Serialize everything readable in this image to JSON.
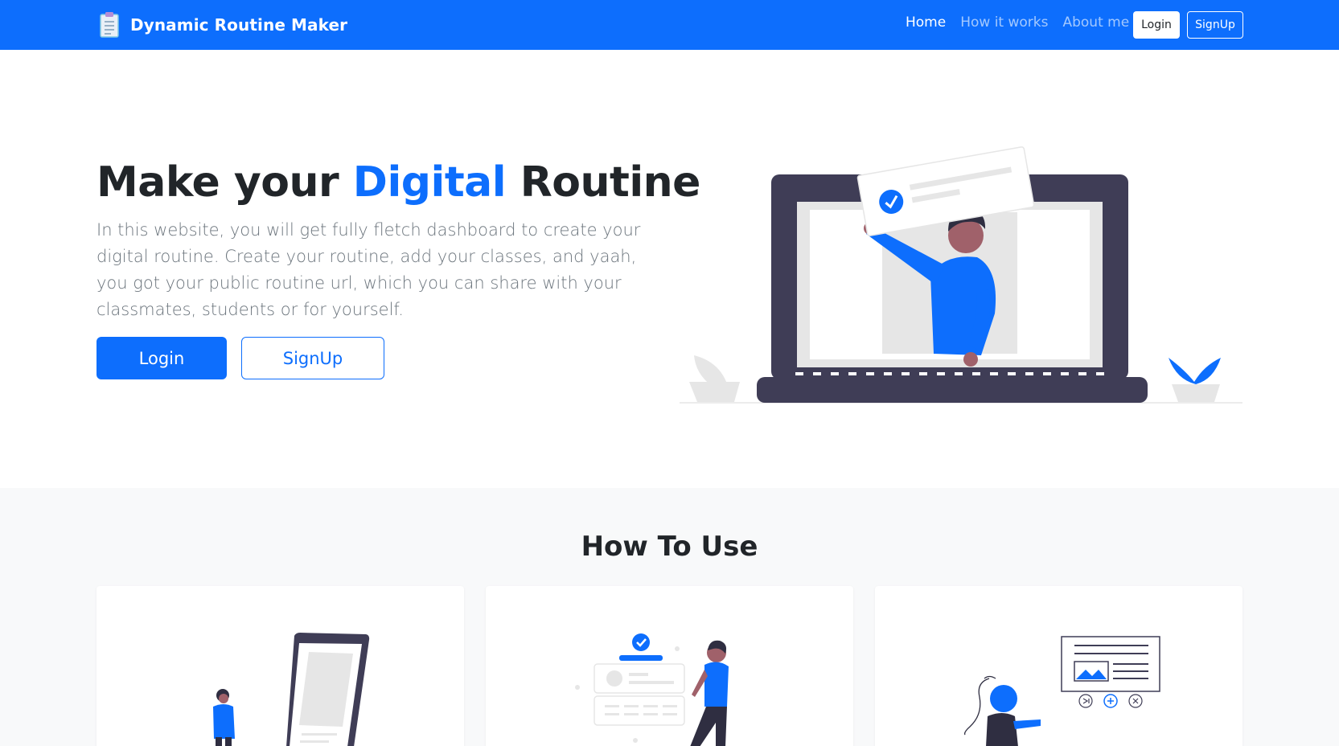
{
  "navbar": {
    "brand": "Dynamic Routine Maker",
    "links": [
      {
        "label": "Home"
      },
      {
        "label": "How it works"
      },
      {
        "label": "About me"
      }
    ],
    "login": "Login",
    "signup": "SignUp",
    "background": "#0d6efd"
  },
  "hero": {
    "title_part1": "Make your ",
    "title_accent": "Digital",
    "title_part2": " Routine",
    "description": "In this website, you will get fully fletch dashboard to create your digital routine. Create your routine, add your classes, and yaah, you got your public routine url, which you can share with your classmates, students or for yourself.",
    "login": "Login",
    "signup": "SignUp",
    "accent_color": "#0d6efd"
  },
  "howto": {
    "title": "How To Use",
    "cards": [
      {
        "icon": "phone-person-illustration"
      },
      {
        "icon": "profile-check-illustration"
      },
      {
        "icon": "web-layout-illustration"
      }
    ]
  }
}
